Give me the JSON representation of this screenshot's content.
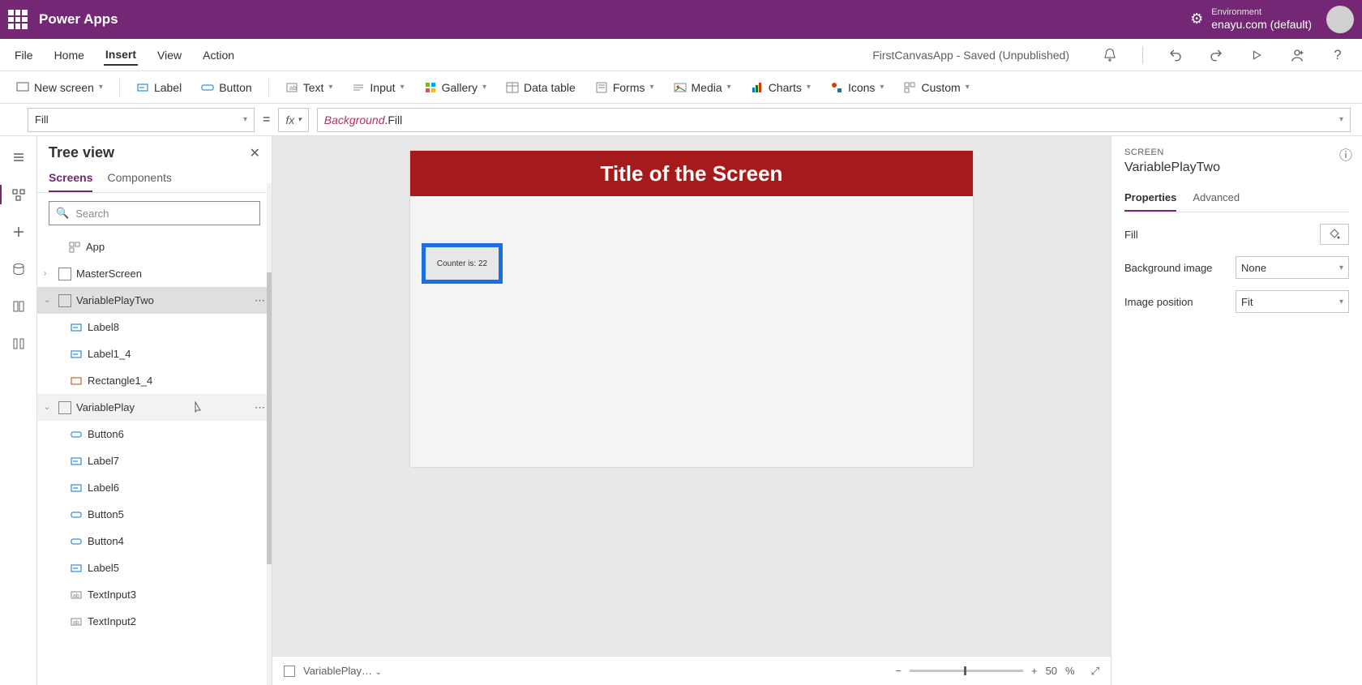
{
  "header": {
    "app_title": "Power Apps",
    "env_label": "Environment",
    "env_value": "enayu.com (default)"
  },
  "menubar": {
    "items": [
      "File",
      "Home",
      "Insert",
      "View",
      "Action"
    ],
    "active": "Insert",
    "saved_text": "FirstCanvasApp - Saved (Unpublished)"
  },
  "ribbon": {
    "new_screen": "New screen",
    "label": "Label",
    "button": "Button",
    "text": "Text",
    "input": "Input",
    "gallery": "Gallery",
    "data_table": "Data table",
    "forms": "Forms",
    "media": "Media",
    "charts": "Charts",
    "icons": "Icons",
    "custom": "Custom"
  },
  "formula": {
    "property": "Fill",
    "fx": "fx",
    "ident": "Background",
    "tail": ".Fill"
  },
  "tree": {
    "title": "Tree view",
    "tabs": {
      "screens": "Screens",
      "components": "Components"
    },
    "search_placeholder": "Search",
    "items": {
      "app": "App",
      "master": "MasterScreen",
      "vpt": "VariablePlayTwo",
      "label8": "Label8",
      "label1_4": "Label1_4",
      "rect1_4": "Rectangle1_4",
      "vp": "VariablePlay",
      "button6": "Button6",
      "label7": "Label7",
      "label6": "Label6",
      "button5": "Button5",
      "button4": "Button4",
      "label5": "Label5",
      "ti3": "TextInput3",
      "ti2": "TextInput2"
    }
  },
  "canvas": {
    "title": "Title of the Screen",
    "button_text": "Counter is: 22",
    "footer_screen": "VariablePlay…",
    "zoom": "50",
    "zoom_pct": "%"
  },
  "props": {
    "section": "SCREEN",
    "name": "VariablePlayTwo",
    "tabs": {
      "properties": "Properties",
      "advanced": "Advanced"
    },
    "fill": "Fill",
    "bg_image": "Background image",
    "bg_image_val": "None",
    "img_pos": "Image position",
    "img_pos_val": "Fit"
  }
}
